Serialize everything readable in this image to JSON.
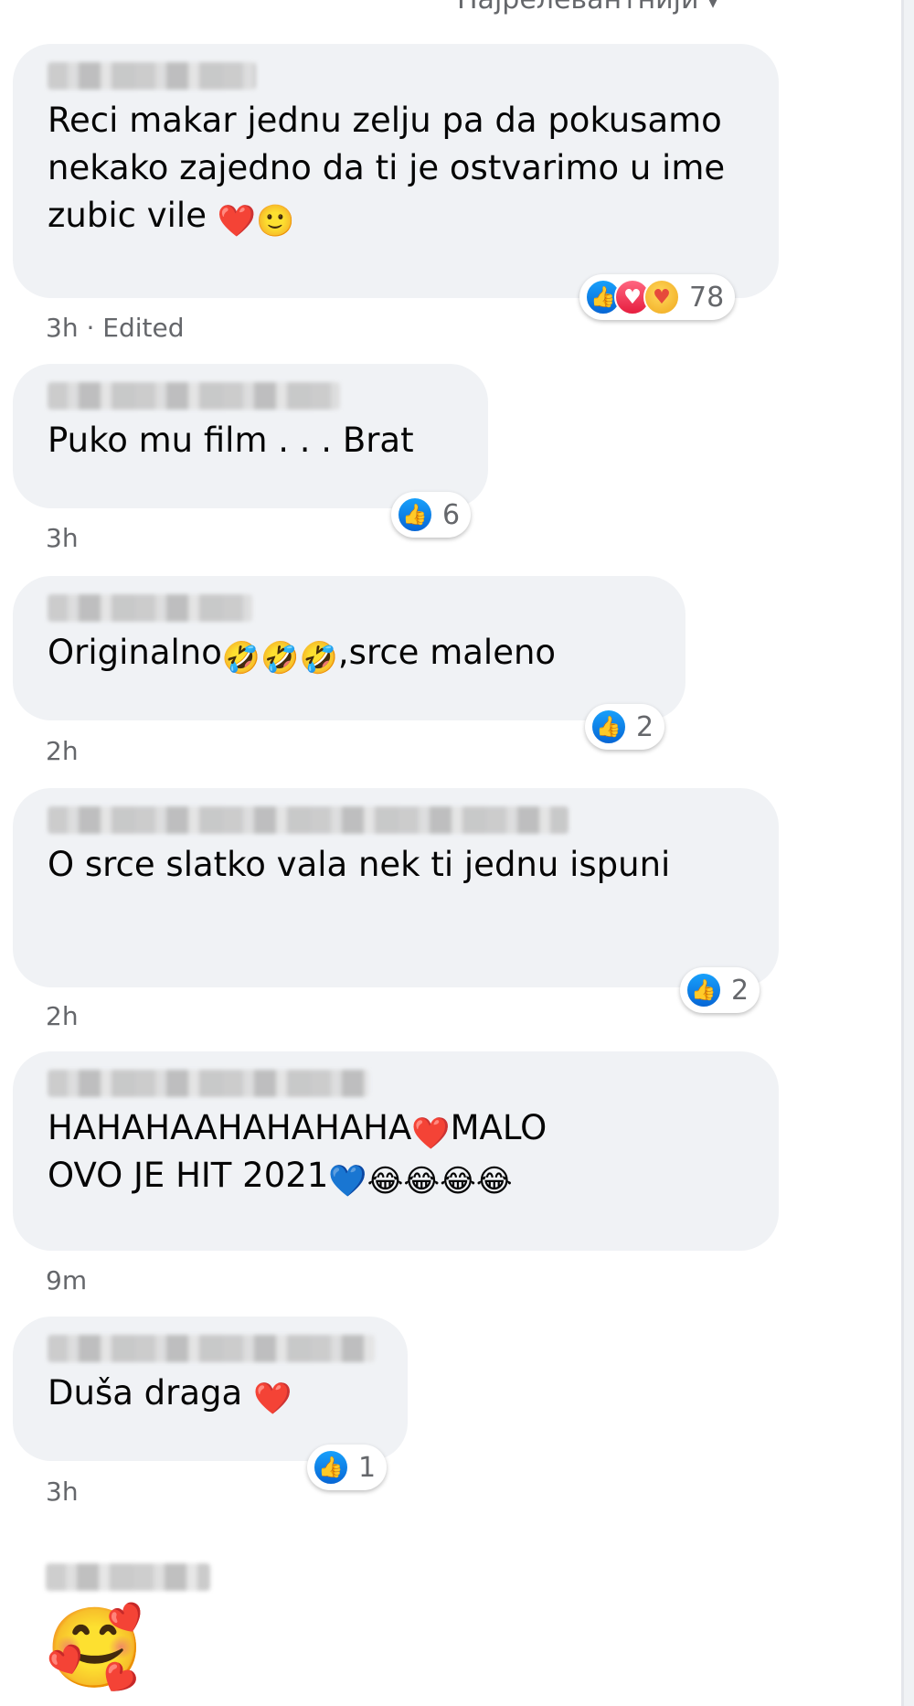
{
  "sort": {
    "label": "Најрелевантнији"
  },
  "comments": [
    {
      "text": "Reci makar jednu zelju pa da pokusamo nekako zajedno da ti je ostvarimo u ime zubic vile",
      "emojis": [
        "❤️",
        "🙂"
      ],
      "reactions": {
        "types": [
          "like",
          "love",
          "care"
        ],
        "count": "78"
      },
      "time": "3h",
      "edited": "Edited"
    },
    {
      "text": "Puko mu film . . . Brat",
      "reactions": {
        "types": [
          "like"
        ],
        "count": "6"
      },
      "time": "3h"
    },
    {
      "text_before": "Originalno",
      "emojis": [
        "🤣",
        "🤣",
        "🤣"
      ],
      "text_after": ",srce maleno",
      "reactions": {
        "types": [
          "like"
        ],
        "count": "2"
      },
      "time": "2h"
    },
    {
      "text": "O srce slatko vala nek ti jednu ispuni",
      "reactions": {
        "types": [
          "like"
        ],
        "count": "2"
      },
      "time": "2h"
    },
    {
      "line1_before": "HAHAHAAHAHAHAHA",
      "line1_emoji": "❤️",
      "line1_after": "MALO",
      "line2_before": "OVO JE HIT 2021",
      "line2_emojis": [
        "💙",
        "😂",
        "😂",
        "😂",
        "😂"
      ],
      "time": "9m"
    },
    {
      "text": "Duša draga",
      "emojis": [
        "❤️"
      ],
      "reactions": {
        "types": [
          "like"
        ],
        "count": "1"
      },
      "time": "3h"
    },
    {
      "emojis": [
        "🥰"
      ]
    }
  ]
}
